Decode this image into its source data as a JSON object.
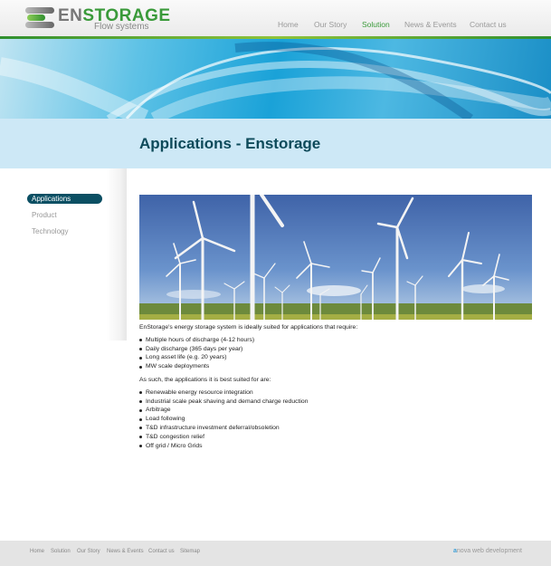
{
  "logo": {
    "en": "EN",
    "storage": "STORAGE",
    "subtitle": "Flow systems"
  },
  "nav": [
    "Home",
    "Our Story",
    "Solution",
    "News & Events",
    "Contact us"
  ],
  "nav_active": "Solution",
  "page_title": "Applications - Enstorage",
  "sidebar": [
    "Applications",
    "Product",
    "Technology"
  ],
  "sidebar_active": "Applications",
  "content": {
    "intro": "EnStorage's energy storage system is ideally suited for applications that require:",
    "requirements": [
      "Multiple hours of discharge (4-12 hours)",
      "Daily discharge (365 days per year)",
      "Long asset life (e.g. 20 years)",
      "MW scale deployments"
    ],
    "suited_intro": "As such, the applications it is best suited for are:",
    "applications": [
      "Renewable energy resource integration",
      "Industrial scale peak shaving and demand charge reduction",
      "Arbitrage",
      "Load following",
      "T&D infrastructure investment deferral/obsoletion",
      "T&D congestion relief",
      "Off grid / Micro Grids"
    ]
  },
  "footer": {
    "links": [
      "Home",
      "Solution",
      "Our Story",
      "News & Events",
      "Contact us",
      "Sitemap"
    ],
    "credit_a": "a",
    "credit_rest": "nova web development"
  },
  "colors": {
    "brand_green": "#3a9a3a",
    "title": "#0d4a5a",
    "active_side": "#0b4f63",
    "title_band": "#cde8f6"
  }
}
